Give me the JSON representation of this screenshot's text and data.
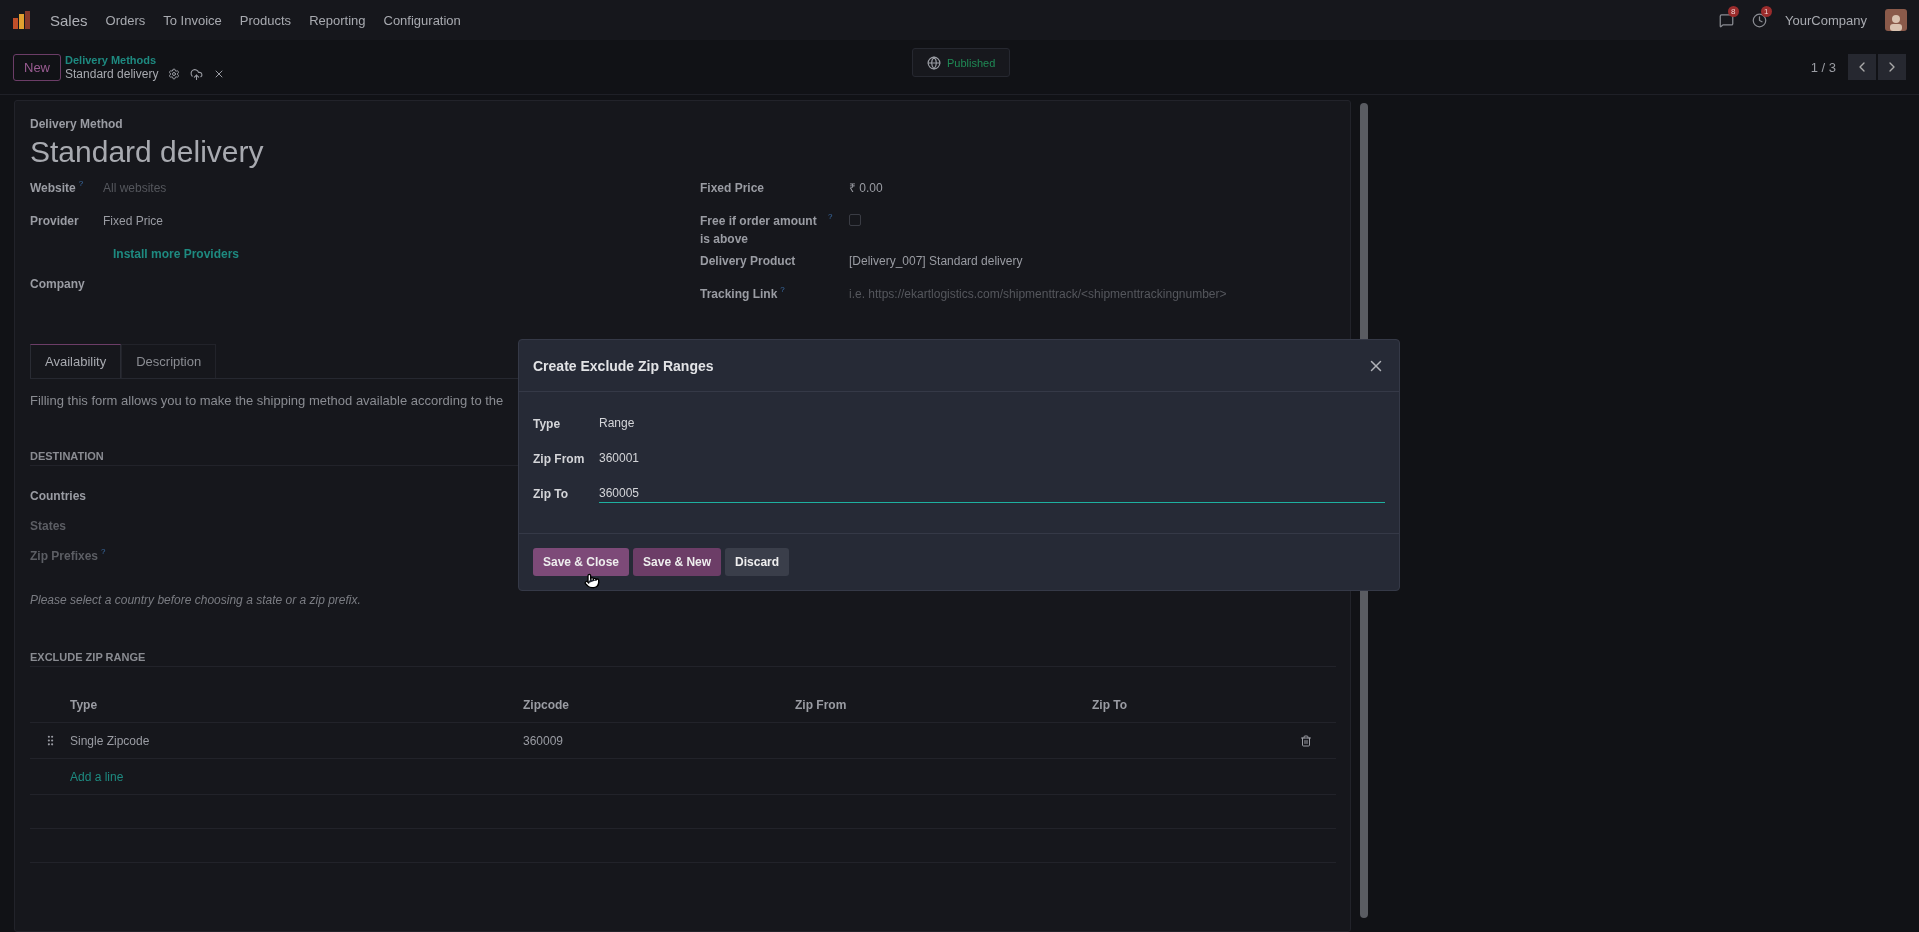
{
  "navbar": {
    "app_name": "Sales",
    "menu": [
      "Orders",
      "To Invoice",
      "Products",
      "Reporting",
      "Configuration"
    ],
    "chat_badge": "8",
    "activity_badge": "1",
    "company": "YourCompany"
  },
  "control_panel": {
    "new_button": "New",
    "breadcrumb_parent": "Delivery Methods",
    "breadcrumb_current": "Standard delivery",
    "status": "Published",
    "pager": "1 / 3"
  },
  "form": {
    "type_label": "Delivery Method",
    "title": "Standard delivery",
    "left_fields": [
      {
        "kind": "field",
        "label": "Website",
        "help": "?",
        "placeholder": "All websites"
      },
      {
        "kind": "field",
        "label": "Provider",
        "value": "Fixed Price"
      },
      {
        "kind": "link",
        "value": "Install more Providers"
      },
      {
        "kind": "field",
        "label": "Company"
      }
    ],
    "right_fields": [
      {
        "kind": "field",
        "label": "Fixed Price",
        "value": "₹ 0.00"
      },
      {
        "kind": "checkbox",
        "label": "Free if order amount is above",
        "help": "?",
        "checked": false
      },
      {
        "kind": "field",
        "label": "Delivery Product",
        "value": "[Delivery_007] Standard delivery"
      },
      {
        "kind": "field",
        "label": "Tracking Link",
        "help": "?",
        "placeholder": "i.e. https://ekartlogistics.com/shipmenttrack/<shipmenttrackingnumber>"
      }
    ],
    "tabs": [
      {
        "label": "Availability",
        "selected": true
      },
      {
        "label": "Description",
        "selected": false
      }
    ],
    "intro": "Filling this form allows you to make the shipping method available according to the",
    "destination": {
      "title": "DESTINATION",
      "fields": [
        {
          "label": "Countries",
          "disabled": false
        },
        {
          "label": "States",
          "disabled": true
        },
        {
          "label": "Zip Prefixes",
          "help": "?",
          "disabled": true
        }
      ],
      "note": "Please select a country before choosing a state or a zip prefix."
    },
    "exclude": {
      "title": "EXCLUDE ZIP RANGE",
      "columns": [
        "Type",
        "Zipcode",
        "Zip From",
        "Zip To"
      ],
      "rows": [
        {
          "type": "Single Zipcode",
          "zipcode": "360009",
          "zip_from": "",
          "zip_to": ""
        }
      ],
      "add_line": "Add a line"
    }
  },
  "dialog": {
    "title": "Create Exclude Zip Ranges",
    "fields": [
      {
        "label": "Type",
        "value": "Range",
        "focused": false
      },
      {
        "label": "Zip From",
        "value": "360001",
        "focused": false
      },
      {
        "label": "Zip To",
        "value": "360005",
        "focused": true
      }
    ],
    "buttons": [
      {
        "label": "Save & Close",
        "kind": "primary"
      },
      {
        "label": "Save & New",
        "kind": "primary"
      },
      {
        "label": "Discard",
        "kind": "secondary"
      }
    ]
  }
}
